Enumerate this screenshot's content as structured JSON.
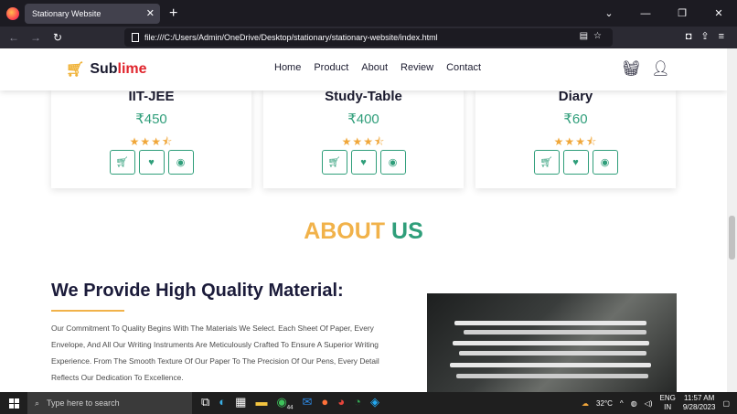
{
  "browser": {
    "tab_title": "Stationary Website",
    "url": "file:///C:/Users/Admin/OneDrive/Desktop/stationary/stationary-website/index.html"
  },
  "site": {
    "logo_part1": "Sub",
    "logo_part2": "lime",
    "nav": [
      "Home",
      "Product",
      "About",
      "Review",
      "Contact"
    ]
  },
  "products": [
    {
      "name": "IIT-JEE",
      "price": "₹450"
    },
    {
      "name": "Study-Table",
      "price": "₹400"
    },
    {
      "name": "Diary",
      "price": "₹60"
    }
  ],
  "about": {
    "title_part1": "ABOUT",
    "title_part2": "US",
    "heading": "We Provide High Quality Material:",
    "paragraph": "Our Commitment To Quality Begins With The Materials We Select. Each Sheet Of Paper, Every Envelope, And All Our Writing Instruments Are Meticulously Crafted To Ensure A Superior Writing Experience. From The Smooth Texture Of Our Paper To The Precision Of Our Pens, Every Detail Reflects Our Dedication To Excellence."
  },
  "taskbar": {
    "search_placeholder": "Type here to search",
    "weather": "32°C",
    "lang1": "ENG",
    "lang2": "IN",
    "time": "11:57 AM",
    "date": "9/28/2023",
    "whatsapp_badge": "44"
  }
}
